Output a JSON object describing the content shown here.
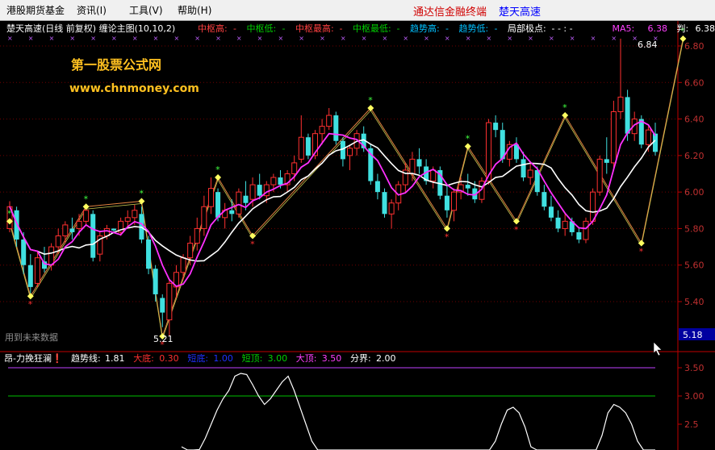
{
  "menu": {
    "items": [
      "港股期货基金",
      "资讯(I)",
      "工具(V)",
      "帮助(H)"
    ],
    "brand_left": "通达信金融终端",
    "brand_right": "楚天高速"
  },
  "main_header": {
    "title": "楚天高速(日线 前复权) 缠论主图(10,10,2)",
    "items": [
      {
        "label": "中枢高:",
        "value": "-",
        "color": "#ff4040"
      },
      {
        "label": "中枢低:",
        "value": "-",
        "color": "#00d000"
      },
      {
        "label": "中枢最高:",
        "value": "-",
        "color": "#ff4040"
      },
      {
        "label": "中枢最低:",
        "value": "-",
        "color": "#00d000"
      },
      {
        "label": "趋势高:",
        "value": "-",
        "color": "#00c0ff"
      },
      {
        "label": "趋势低:",
        "value": "-",
        "color": "#00c0ff"
      },
      {
        "label": "局部极点:",
        "value": "-  -  :  -",
        "color": "#ffffff"
      },
      {
        "label": "MA5:",
        "value": "6.38",
        "color": "#ff40ff"
      },
      {
        "label": "判:",
        "value": "6.38",
        "color": "#ffffff"
      }
    ]
  },
  "watermark": {
    "line1": "第一股票公式网",
    "line2": "www.chnmoney.com"
  },
  "future_data_label": "用到未来数据",
  "annotations": {
    "high": "6.84",
    "low": "5.21"
  },
  "price_axis": {
    "labels": [
      "6.80",
      "6.60",
      "6.40",
      "6.20",
      "6.00",
      "5.80",
      "5.60",
      "5.40"
    ],
    "current": "5.18"
  },
  "sub_header": {
    "title": "昂-力挽狂澜❗",
    "items": [
      {
        "label": "趋势线:",
        "value": "1.81",
        "color": "#ffffff"
      },
      {
        "label": "大底:",
        "value": "0.30",
        "color": "#ff3030"
      },
      {
        "label": "短底:",
        "value": "1.00",
        "color": "#2030ff"
      },
      {
        "label": "短顶:",
        "value": "3.00",
        "color": "#00d000"
      },
      {
        "label": "大顶:",
        "value": "3.50",
        "color": "#ff40ff"
      },
      {
        "label": "分界:",
        "value": "2.00",
        "color": "#ffffff"
      }
    ]
  },
  "sub_axis": {
    "labels": [
      "3.50",
      "3.00",
      "2.5"
    ]
  },
  "chart_data": {
    "type": "candlestick",
    "candles": [
      [
        5.8,
        5.95,
        5.78,
        5.92
      ],
      [
        5.9,
        5.92,
        5.7,
        5.74
      ],
      [
        5.74,
        5.78,
        5.55,
        5.6
      ],
      [
        5.6,
        5.66,
        5.43,
        5.48
      ],
      [
        5.5,
        5.68,
        5.48,
        5.64
      ],
      [
        5.62,
        5.7,
        5.56,
        5.58
      ],
      [
        5.6,
        5.72,
        5.57,
        5.7
      ],
      [
        5.7,
        5.8,
        5.66,
        5.76
      ],
      [
        5.76,
        5.84,
        5.72,
        5.82
      ],
      [
        5.8,
        5.86,
        5.74,
        5.78
      ],
      [
        5.8,
        5.88,
        5.76,
        5.84
      ],
      [
        5.84,
        5.92,
        5.82,
        5.9
      ],
      [
        5.88,
        5.9,
        5.62,
        5.64
      ],
      [
        5.66,
        5.78,
        5.62,
        5.76
      ],
      [
        5.76,
        5.82,
        5.74,
        5.8
      ],
      [
        5.8,
        5.8,
        5.78,
        5.79
      ],
      [
        5.78,
        5.86,
        5.76,
        5.84
      ],
      [
        5.84,
        5.9,
        5.8,
        5.86
      ],
      [
        5.86,
        5.93,
        5.82,
        5.9
      ],
      [
        5.88,
        5.92,
        5.72,
        5.74
      ],
      [
        5.74,
        5.76,
        5.55,
        5.58
      ],
      [
        5.58,
        5.6,
        5.4,
        5.44
      ],
      [
        5.42,
        5.44,
        5.26,
        5.34
      ],
      [
        5.3,
        5.52,
        5.21,
        5.5
      ],
      [
        5.48,
        5.6,
        5.42,
        5.56
      ],
      [
        5.56,
        5.66,
        5.52,
        5.64
      ],
      [
        5.64,
        5.76,
        5.6,
        5.72
      ],
      [
        5.72,
        5.86,
        5.68,
        5.8
      ],
      [
        5.8,
        5.98,
        5.76,
        5.92
      ],
      [
        5.92,
        6.08,
        5.88,
        6.02
      ],
      [
        6.0,
        6.02,
        5.84,
        5.86
      ],
      [
        5.86,
        5.94,
        5.8,
        5.9
      ],
      [
        5.9,
        5.96,
        5.84,
        5.88
      ],
      [
        5.88,
        6.02,
        5.86,
        6.0
      ],
      [
        5.98,
        6.06,
        5.9,
        5.94
      ],
      [
        5.96,
        6.08,
        5.92,
        6.04
      ],
      [
        6.04,
        6.1,
        5.96,
        5.98
      ],
      [
        5.98,
        6.06,
        5.94,
        6.04
      ],
      [
        6.04,
        6.1,
        6.0,
        6.08
      ],
      [
        6.08,
        6.12,
        6.02,
        6.04
      ],
      [
        6.04,
        6.12,
        6.0,
        6.1
      ],
      [
        6.1,
        6.2,
        6.06,
        6.16
      ],
      [
        6.18,
        6.42,
        6.16,
        6.3
      ],
      [
        6.3,
        6.32,
        6.18,
        6.2
      ],
      [
        6.2,
        6.34,
        6.18,
        6.32
      ],
      [
        6.32,
        6.4,
        6.26,
        6.36
      ],
      [
        6.36,
        6.46,
        6.34,
        6.42
      ],
      [
        6.42,
        6.44,
        6.26,
        6.28
      ],
      [
        6.28,
        6.3,
        6.14,
        6.18
      ],
      [
        6.2,
        6.26,
        6.12,
        6.24
      ],
      [
        6.24,
        6.34,
        6.2,
        6.32
      ],
      [
        6.32,
        6.36,
        6.22,
        6.24
      ],
      [
        6.24,
        6.26,
        6.04,
        6.06
      ],
      [
        6.06,
        6.1,
        5.96,
        6.0
      ],
      [
        6.0,
        6.02,
        5.86,
        5.88
      ],
      [
        5.88,
        5.96,
        5.8,
        5.94
      ],
      [
        5.94,
        6.06,
        5.9,
        6.04
      ],
      [
        6.04,
        6.16,
        6.0,
        6.12
      ],
      [
        6.1,
        6.22,
        6.06,
        6.18
      ],
      [
        6.18,
        6.24,
        6.1,
        6.14
      ],
      [
        6.14,
        6.18,
        6.04,
        6.06
      ],
      [
        6.06,
        6.14,
        6.02,
        6.12
      ],
      [
        6.12,
        6.14,
        5.96,
        5.98
      ],
      [
        5.98,
        6.04,
        5.86,
        5.9
      ],
      [
        5.9,
        6.02,
        5.84,
        6.0
      ],
      [
        6.0,
        6.08,
        5.96,
        6.04
      ],
      [
        6.04,
        6.1,
        5.98,
        6.02
      ],
      [
        6.02,
        6.06,
        5.94,
        5.96
      ],
      [
        5.96,
        6.08,
        5.94,
        6.06
      ],
      [
        6.06,
        6.4,
        6.04,
        6.38
      ],
      [
        6.38,
        6.42,
        6.3,
        6.34
      ],
      [
        6.34,
        6.38,
        6.16,
        6.18
      ],
      [
        6.18,
        6.28,
        6.14,
        6.26
      ],
      [
        6.26,
        6.3,
        6.16,
        6.18
      ],
      [
        6.18,
        6.22,
        6.06,
        6.08
      ],
      [
        6.08,
        6.16,
        6.04,
        6.12
      ],
      [
        6.12,
        6.14,
        5.98,
        6.0
      ],
      [
        6.0,
        6.04,
        5.9,
        5.92
      ],
      [
        5.92,
        5.98,
        5.84,
        5.86
      ],
      [
        5.86,
        5.9,
        5.78,
        5.8
      ],
      [
        5.8,
        5.88,
        5.76,
        5.84
      ],
      [
        5.84,
        5.86,
        5.76,
        5.78
      ],
      [
        5.78,
        5.8,
        5.72,
        5.74
      ],
      [
        5.74,
        5.86,
        5.72,
        5.84
      ],
      [
        5.84,
        6.02,
        5.82,
        6.0
      ],
      [
        6.0,
        6.2,
        5.98,
        6.18
      ],
      [
        6.18,
        6.3,
        6.1,
        6.16
      ],
      [
        6.16,
        6.5,
        6.12,
        6.44
      ],
      [
        6.44,
        6.84,
        6.4,
        6.52
      ],
      [
        6.52,
        6.56,
        6.28,
        6.32
      ],
      [
        6.32,
        6.44,
        6.28,
        6.4
      ],
      [
        6.4,
        6.42,
        6.24,
        6.26
      ],
      [
        6.26,
        6.36,
        6.22,
        6.34
      ],
      [
        6.32,
        6.38,
        6.2,
        6.22
      ]
    ],
    "zigzag": [
      [
        0,
        5.84
      ],
      [
        3,
        5.43
      ],
      [
        11,
        5.92
      ],
      [
        19,
        5.95
      ],
      [
        22,
        5.21
      ],
      [
        30,
        6.08
      ],
      [
        35,
        5.76
      ],
      [
        52,
        6.46
      ],
      [
        63,
        5.8
      ],
      [
        66,
        6.25
      ],
      [
        73,
        5.84
      ],
      [
        80,
        6.42
      ],
      [
        91,
        5.72
      ],
      [
        97,
        6.84
      ]
    ],
    "sub_series": [
      2.1,
      2.0,
      1.9,
      2.05,
      2.25,
      2.5,
      2.75,
      2.95,
      3.1,
      3.35,
      3.4,
      3.38,
      3.2,
      3.0,
      2.85,
      2.95,
      3.1,
      3.25,
      3.35,
      3.1,
      2.8,
      2.5,
      2.2,
      2.0,
      1.8,
      1.6,
      1.4,
      1.3,
      1.2,
      1.1,
      1.05,
      1.0,
      0.95,
      0.9,
      0.9,
      0.95,
      1.0,
      1.1,
      1.2,
      1.3,
      1.2,
      1.1,
      1.0,
      1.0,
      1.0,
      1.0,
      1.0,
      1.0,
      1.0,
      1.1,
      1.3,
      1.6,
      1.9,
      2.2,
      2.5,
      2.75,
      2.8,
      2.7,
      2.45,
      2.1,
      1.8,
      1.5,
      1.2,
      1.0,
      1.0,
      1.0,
      1.0,
      1.0,
      1.1,
      1.4,
      1.8,
      2.3,
      2.7,
      2.85,
      2.8,
      2.7,
      2.5,
      2.2,
      1.9,
      1.6,
      1.3
    ]
  }
}
